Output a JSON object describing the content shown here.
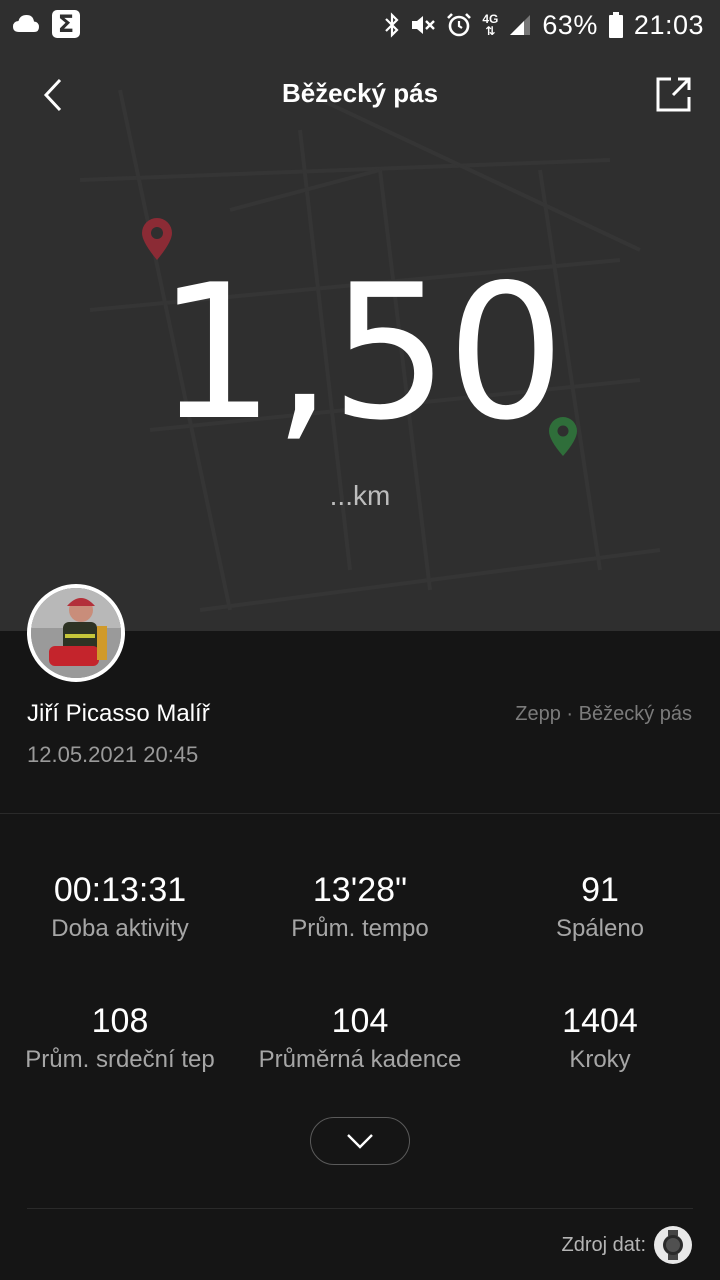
{
  "status_bar": {
    "battery": "63%",
    "time": "21:03",
    "network": "4G",
    "icons": [
      "cloud-icon",
      "sigma-app-icon",
      "bluetooth-icon",
      "mute-icon",
      "alarm-icon",
      "signal-icon",
      "battery-icon"
    ]
  },
  "header": {
    "title": "Běžecký pás"
  },
  "workout": {
    "distance": "1,50",
    "unit": "...km"
  },
  "profile": {
    "name": "Jiří Picasso Malíř",
    "datetime": "12.05.2021 20:45",
    "source_app": "Zepp · Běžecký pás"
  },
  "stats": [
    {
      "value": "00:13:31",
      "label": "Doba aktivity"
    },
    {
      "value": "13'28\"",
      "label": "Prům. tempo"
    },
    {
      "value": "91",
      "label": "Spáleno"
    },
    {
      "value": "108",
      "label": "Prům. srdeční tep"
    },
    {
      "value": "104",
      "label": "Průměrná kadence"
    },
    {
      "value": "1404",
      "label": "Kroky"
    }
  ],
  "footer": {
    "data_source_label": "Zdroj dat:"
  },
  "colors": {
    "hero_bg": "#2f2f2f",
    "body_bg": "#151515",
    "start_pin": "#8b2b35",
    "end_pin": "#2f6e3a"
  }
}
